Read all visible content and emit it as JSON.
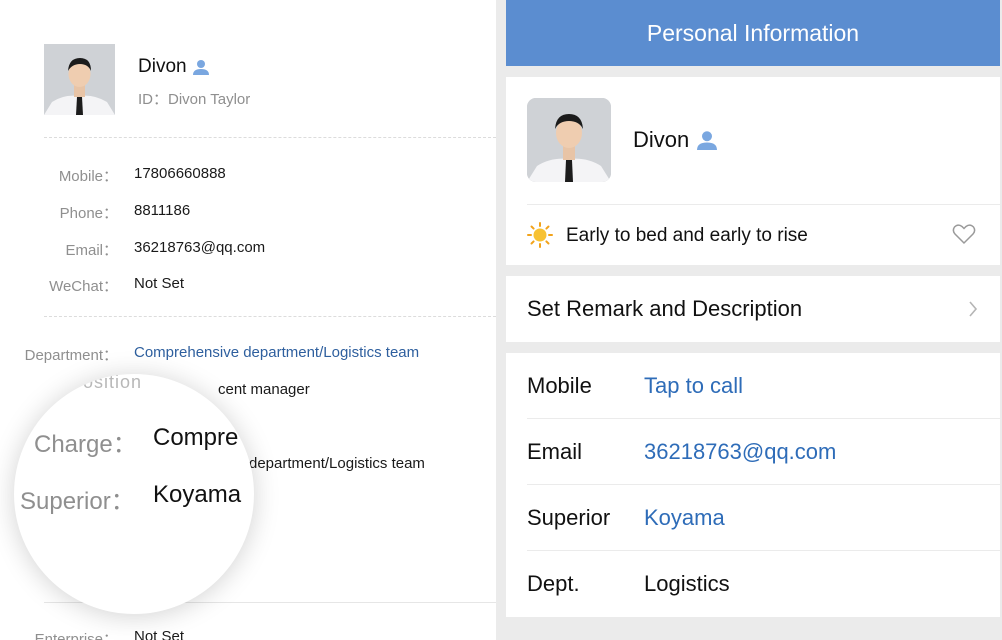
{
  "left": {
    "profile": {
      "name": "Divon",
      "id_label": "ID：",
      "id_value": "Divon Taylor"
    },
    "contact_rows": [
      {
        "label": "Mobile：",
        "value": "17806660888"
      },
      {
        "label": "Phone：",
        "value": "8811186"
      },
      {
        "label": "Email：",
        "value": "36218763@qq.com"
      },
      {
        "label": "WeChat：",
        "value": "Not Set"
      }
    ],
    "department": {
      "label": "Department：",
      "value": "Comprehensive department/Logistics team"
    },
    "position_partial": "cent manager",
    "charge_partial": "department/Logistics team",
    "magnifier": {
      "charge_label": "Charge：",
      "charge_value": "Compre",
      "superior_label": "Superior：",
      "superior_value": "Koyama",
      "top_fragment": "Position"
    },
    "enterprise": {
      "label": "Enterprise：",
      "value": "Not Set"
    }
  },
  "right": {
    "title": "Personal Information",
    "profile_name": "Divon",
    "status_text": "Early to bed and early to rise",
    "remark_label": "Set Remark and Description",
    "rows": [
      {
        "label": "Mobile",
        "value": "Tap to call",
        "link": true
      },
      {
        "label": "Email",
        "value": "36218763@qq.com",
        "link": true
      },
      {
        "label": "Superior",
        "value": "Koyama",
        "link": true
      },
      {
        "label": "Dept.",
        "value": "Logistics",
        "link": false
      }
    ]
  },
  "colors": {
    "header": "#5b8dd0",
    "link_left": "#2e5f9e",
    "link_right": "#2e6cb8",
    "person_icon": "#7aa7e0"
  }
}
